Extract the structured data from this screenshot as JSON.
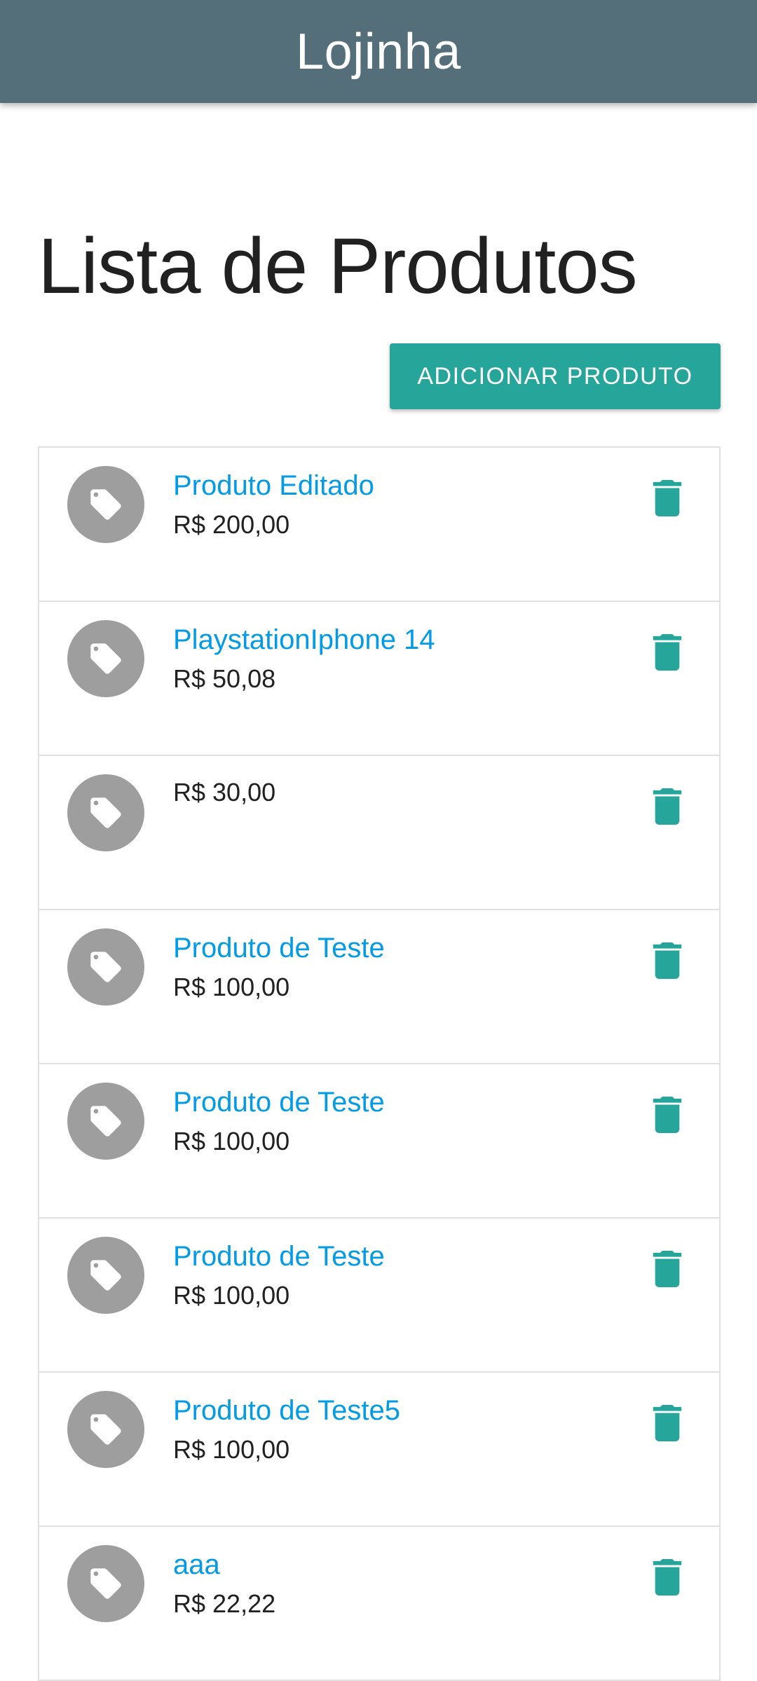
{
  "app": {
    "title": "Lojinha",
    "primary_color": "#546e7a",
    "accent_color": "#26a69a",
    "link_color": "#039be5"
  },
  "page": {
    "title": "Lista de Produtos"
  },
  "actions": {
    "add_product_label": "ADICIONAR PRODUTO"
  },
  "products": [
    {
      "name": "Produto Editado",
      "price": "R$ 200,00",
      "icon": "tag-icon",
      "delete_icon": "trash-icon"
    },
    {
      "name": "PlaystationIphone 14",
      "price": "R$ 50,08",
      "icon": "tag-icon",
      "delete_icon": "trash-icon"
    },
    {
      "name": "",
      "price": "R$ 30,00",
      "icon": "tag-icon",
      "delete_icon": "trash-icon"
    },
    {
      "name": "Produto de Teste",
      "price": "R$ 100,00",
      "icon": "tag-icon",
      "delete_icon": "trash-icon"
    },
    {
      "name": "Produto de Teste",
      "price": "R$ 100,00",
      "icon": "tag-icon",
      "delete_icon": "trash-icon"
    },
    {
      "name": "Produto de Teste",
      "price": "R$ 100,00",
      "icon": "tag-icon",
      "delete_icon": "trash-icon"
    },
    {
      "name": "Produto de Teste5",
      "price": "R$ 100,00",
      "icon": "tag-icon",
      "delete_icon": "trash-icon"
    },
    {
      "name": "aaa",
      "price": "R$ 22,22",
      "icon": "tag-icon",
      "delete_icon": "trash-icon"
    }
  ]
}
